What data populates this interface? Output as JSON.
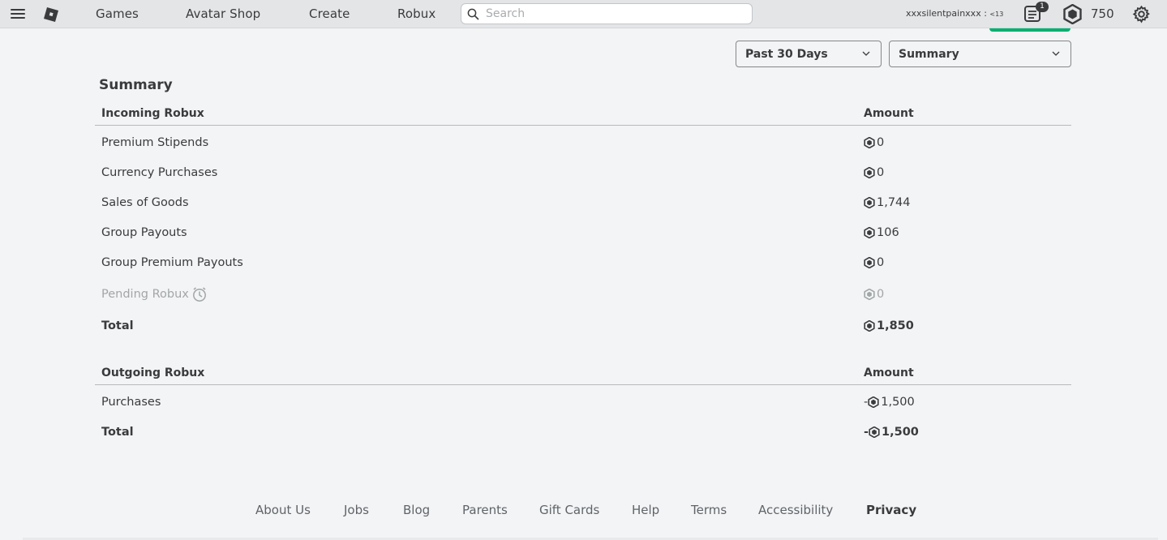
{
  "header": {
    "nav": [
      "Games",
      "Avatar Shop",
      "Create",
      "Robux"
    ],
    "search_placeholder": "Search",
    "username": "xxxsilentpainxxx :",
    "age_label": "<13",
    "notification_count": "1",
    "robux_balance": "750",
    "icons": [
      "menu-icon",
      "roblox-logo-icon",
      "search-icon",
      "notifications-icon",
      "robux-icon",
      "gear-icon"
    ]
  },
  "filters": {
    "period": "Past 30 Days",
    "view": "Summary"
  },
  "summary": {
    "title": "Summary",
    "incoming": {
      "header": "Incoming Robux",
      "amount_header": "Amount",
      "rows": [
        {
          "label": "Premium Stipends",
          "amount": "0"
        },
        {
          "label": "Currency Purchases",
          "amount": "0"
        },
        {
          "label": "Sales of Goods",
          "amount": "1,744"
        },
        {
          "label": "Group Payouts",
          "amount": "106"
        },
        {
          "label": "Group Premium Payouts",
          "amount": "0"
        }
      ],
      "pending": {
        "label": "Pending Robux",
        "amount": "0"
      },
      "total": {
        "label": "Total",
        "amount": "1,850"
      }
    },
    "outgoing": {
      "header": "Outgoing Robux",
      "amount_header": "Amount",
      "rows": [
        {
          "label": "Purchases",
          "amount": "1,500",
          "prefix": "-"
        }
      ],
      "total": {
        "label": "Total",
        "amount": "1,500",
        "prefix": "-"
      }
    }
  },
  "footer": {
    "links": [
      "About Us",
      "Jobs",
      "Blog",
      "Parents",
      "Gift Cards",
      "Help",
      "Terms",
      "Accessibility",
      "Privacy"
    ]
  },
  "colors": {
    "background": "#f2f4f5",
    "topbar": "#e3e5e7",
    "text": "#393b3d",
    "accent_green": "#00b06f"
  }
}
